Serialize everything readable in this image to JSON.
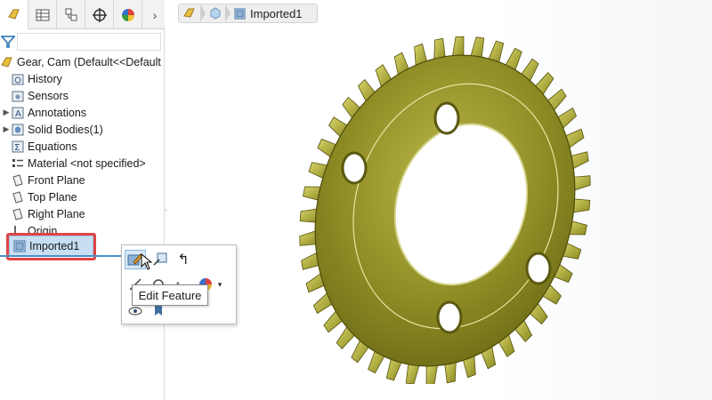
{
  "tabs": [
    {
      "name": "feature-manager",
      "icon": "feature-manager-icon"
    },
    {
      "name": "property-manager",
      "icon": "property-manager-icon"
    },
    {
      "name": "configuration-manager",
      "icon": "configuration-manager-icon"
    },
    {
      "name": "dimxpert-manager",
      "icon": "dimxpert-icon"
    },
    {
      "name": "display-manager",
      "icon": "display-manager-icon"
    }
  ],
  "tree": {
    "root_label": "Gear, Cam  (Default<<Default",
    "items": [
      {
        "label": "History",
        "icon": "history-folder-icon",
        "expandable": false
      },
      {
        "label": "Sensors",
        "icon": "sensors-icon",
        "expandable": false
      },
      {
        "label": "Annotations",
        "icon": "annotations-icon",
        "expandable": true
      },
      {
        "label": "Solid Bodies(1)",
        "icon": "solid-bodies-icon",
        "expandable": true
      },
      {
        "label": "Equations",
        "icon": "equations-icon",
        "expandable": false
      },
      {
        "label": "Material <not specified>",
        "icon": "material-icon",
        "expandable": false
      },
      {
        "label": "Front Plane",
        "icon": "plane-icon",
        "expandable": false
      },
      {
        "label": "Top Plane",
        "icon": "plane-icon",
        "expandable": false
      },
      {
        "label": "Right Plane",
        "icon": "plane-icon",
        "expandable": false
      },
      {
        "label": "Origin",
        "icon": "origin-icon",
        "expandable": false
      },
      {
        "label": "Imported1",
        "icon": "imported-feature-icon",
        "expandable": false,
        "selected": true
      }
    ]
  },
  "breadcrumb": {
    "label": "Imported1"
  },
  "context_toolbar": {
    "tooltip": "Edit Feature"
  },
  "colors": {
    "selection": "#c7def3",
    "highlight_box": "#e04545",
    "connector": "#4a90c8",
    "gear": "#9c9a2e"
  }
}
